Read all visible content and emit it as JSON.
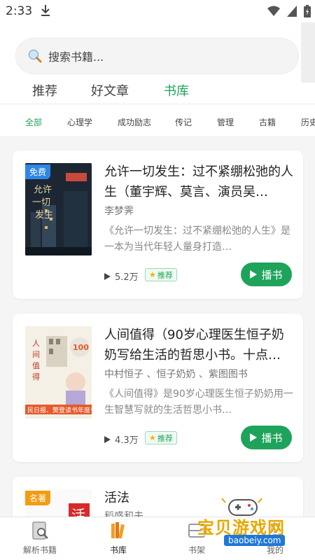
{
  "status_bar": {
    "time": "2:33"
  },
  "search": {
    "placeholder": "搜索书籍..."
  },
  "tabs": [
    {
      "label": "推荐"
    },
    {
      "label": "好文章"
    },
    {
      "label": "书库"
    }
  ],
  "categories": [
    {
      "label": "全部"
    },
    {
      "label": "心理学"
    },
    {
      "label": "成功励志"
    },
    {
      "label": "传记"
    },
    {
      "label": "管理"
    },
    {
      "label": "古籍"
    },
    {
      "label": "历史"
    }
  ],
  "books": [
    {
      "badge": "免费",
      "title": "允许一切发生：过不紧绷松弛的人生（董宇辉、莫言、演员吴…",
      "author": "李梦霁",
      "desc": "《允许一切发生：过不紧绷松弛的人生》是一本为当代年轻人量身打造…",
      "plays": "5.2万",
      "rec": "推荐",
      "play_label": "播书",
      "cover_colors": [
        "#1f2c38",
        "#d6a33a"
      ]
    },
    {
      "badge": "",
      "title": "人间值得（90岁心理医生恒子奶奶写给生活的哲思小书。十点…",
      "author": "中村恒子 、恒子奶奶 、紫图图书",
      "desc": "《人间值得》是90岁心理医生恒子奶奶用一生智慧写就的生活哲思小书…",
      "plays": "4.3万",
      "rec": "推荐",
      "play_label": "播书",
      "cover_colors": [
        "#f3efe6",
        "#e55a2b"
      ]
    },
    {
      "badge": "名著",
      "title": "活法",
      "author": "稻盛和夫",
      "desc": "",
      "plays": "",
      "rec": "",
      "play_label": "",
      "cover_colors": [
        "#ffffff",
        "#d62b2b"
      ]
    }
  ],
  "bottom_nav": [
    {
      "label": "解析书籍",
      "icon": "book-search-icon"
    },
    {
      "label": "书库",
      "icon": "library-icon"
    },
    {
      "label": "书架",
      "icon": "bookshelf-icon"
    },
    {
      "label": "我的",
      "icon": "profile-icon"
    }
  ],
  "watermark": {
    "text": "宝贝游戏网",
    "url": "baobeiy.com"
  },
  "colors": {
    "accent": "#1ea35a",
    "free_badge": "#2e86e6",
    "classic_badge": "#f39c12"
  }
}
